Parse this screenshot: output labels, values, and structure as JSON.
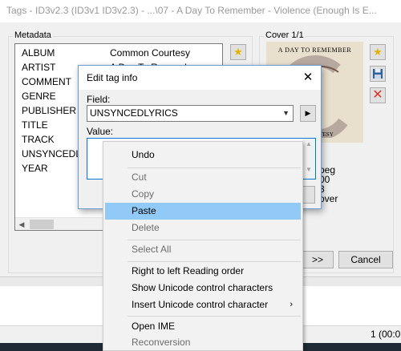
{
  "window": {
    "title": "Tags - ID3v2.3 (ID3v1 ID3v2.3) - ...\\07 - A Day To Remember - Violence (Enough Is E..."
  },
  "metadata": {
    "group_label": "Metadata",
    "rows": [
      {
        "field": "ALBUM",
        "value": "Common Courtesy"
      },
      {
        "field": "ARTIST",
        "value": "A Day To Remember"
      },
      {
        "field": "COMMENT",
        "value": ""
      },
      {
        "field": "GENRE",
        "value": ""
      },
      {
        "field": "PUBLISHER",
        "value": ""
      },
      {
        "field": "TITLE",
        "value": ""
      },
      {
        "field": "TRACK",
        "value": ""
      },
      {
        "field": "UNSYNCEDLYR",
        "value": ""
      },
      {
        "field": "YEAR",
        "value": ""
      }
    ]
  },
  "cover": {
    "group_label": "Cover 1/1",
    "image_text_top": "A DAY TO REMEMBER",
    "image_text_bottom": "RTESY",
    "info_lines": [
      "peg",
      "00",
      "3",
      "over"
    ]
  },
  "buttons": {
    "next": ">>",
    "cancel": "Cancel"
  },
  "dialog": {
    "title": "Edit tag info",
    "field_label": "Field:",
    "field_value": "UNSYNCEDLYRICS",
    "value_label": "Value:"
  },
  "context_menu": {
    "items": [
      {
        "label": "Undo",
        "disabled": false
      },
      {
        "label": "Cut",
        "disabled": true
      },
      {
        "label": "Copy",
        "disabled": true
      },
      {
        "label": "Paste",
        "disabled": false,
        "highlighted": true
      },
      {
        "label": "Delete",
        "disabled": true
      },
      {
        "label": "Select All",
        "disabled": true
      },
      {
        "label": "Right to left Reading order",
        "disabled": false
      },
      {
        "label": "Show Unicode control characters",
        "disabled": false
      },
      {
        "label": "Insert Unicode control character",
        "disabled": false,
        "submenu": true
      },
      {
        "label": "Open IME",
        "disabled": false
      },
      {
        "label": "Reconversion",
        "disabled": true
      }
    ]
  },
  "statusbar": {
    "text": "1 (00:0"
  },
  "colors": {
    "highlight": "#91c9f7",
    "dialog_border": "#6a9ad0",
    "delete_icon": "#d9342b"
  }
}
